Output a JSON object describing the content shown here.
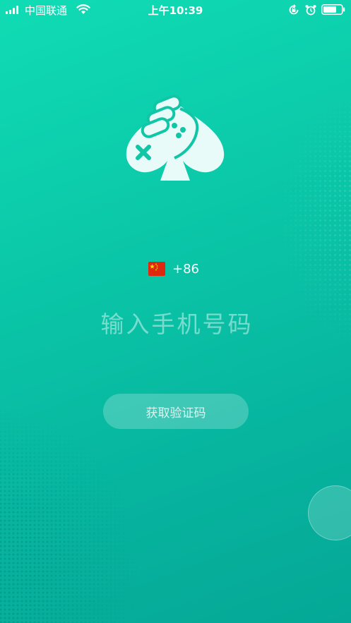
{
  "status_bar": {
    "carrier": "中国联通",
    "time": "上午10:39",
    "icons": [
      "signal-icon",
      "wifi-icon",
      "rotation-lock-icon",
      "alarm-icon",
      "battery-icon"
    ]
  },
  "logo": {
    "icon": "spade-fist-gamepad-logo"
  },
  "phone_prefix": {
    "flag_icon": "china-flag-icon",
    "country_code": "+86"
  },
  "phone_input": {
    "value": "",
    "placeholder": "输入手机号码"
  },
  "get_code_button": {
    "label": "获取验证码"
  },
  "floating_button": {
    "icon": "assistive-touch"
  },
  "colors": {
    "background_top": "#10dcb4",
    "background_bottom": "#05a896",
    "text": "#ffffff"
  }
}
